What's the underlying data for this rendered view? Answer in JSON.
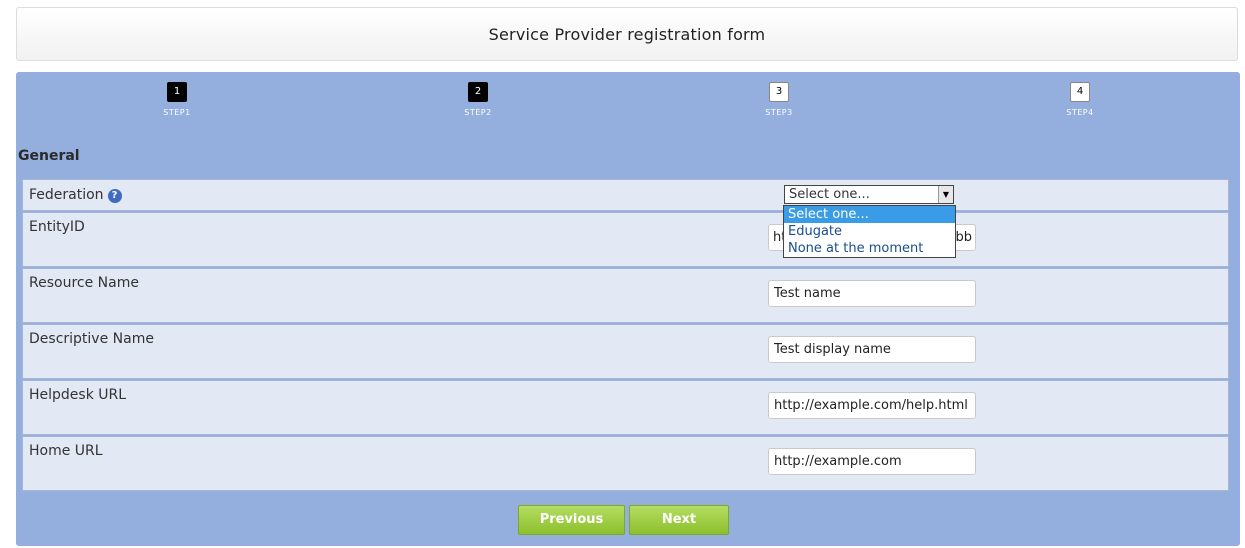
{
  "title": "Service Provider registration form",
  "steps": [
    {
      "number": "1",
      "label": "STEP1",
      "completed": true
    },
    {
      "number": "2",
      "label": "STEP2",
      "completed": true
    },
    {
      "number": "3",
      "label": "STEP3",
      "completed": false
    },
    {
      "number": "4",
      "label": "STEP4",
      "completed": false
    }
  ],
  "section_title": "General",
  "fields": {
    "federation": {
      "label": "Federation",
      "help_glyph": "?",
      "selected": "Select one...",
      "options": [
        "Select one...",
        "Edugate",
        "None at the moment"
      ]
    },
    "entity_id": {
      "label": "EntityID",
      "value_start": "ht",
      "value_end": "bb"
    },
    "resource_name": {
      "label": "Resource Name",
      "value": "Test name"
    },
    "descriptive_name": {
      "label": "Descriptive Name",
      "value": "Test display name"
    },
    "helpdesk_url": {
      "label": "Helpdesk URL",
      "value": "http://example.com/help.html"
    },
    "home_url": {
      "label": "Home URL",
      "value": "http://example.com"
    }
  },
  "buttons": {
    "previous": "Previous",
    "next": "Next"
  },
  "icons": {
    "help": "help-icon",
    "dropdown_arrow": "chevron-down-icon"
  },
  "colors": {
    "panel": "#94aedd",
    "row": "#e2e8f4",
    "button": "#9acb3a",
    "highlight": "#3a9ce6"
  }
}
